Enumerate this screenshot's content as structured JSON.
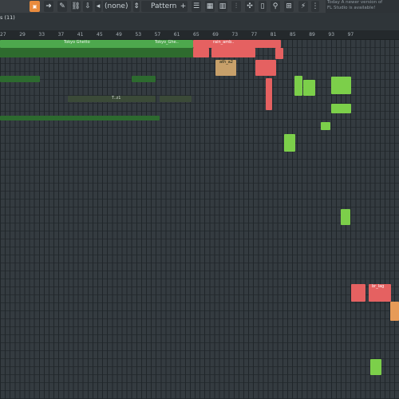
{
  "toolbar": {
    "pattern_label": "Pattern 1",
    "channel_select": "(none)",
    "news_line1": "Today  A newer version of",
    "news_line2": "FL Studio is available!"
  },
  "playlist": {
    "title": "s (11)",
    "ruler_ticks": [
      "27",
      "29",
      "33",
      "37",
      "41",
      "45",
      "49",
      "53",
      "57",
      "61",
      "65",
      "69",
      "73",
      "77",
      "81",
      "85",
      "89",
      "93",
      "97"
    ],
    "clip_labels": {
      "tokyo1": "Tokyo Ghetto",
      "tokyo2": "Tokyo_Ghe..",
      "tokyo3": "Tokyo_Ghe..",
      "rain": "rain_amb..",
      "ath": "ath_a2",
      "tz": "T..z1",
      "br_lag": "br_lag"
    }
  },
  "colors": {
    "green": "#4da84d",
    "dark_green": "#2d6a2f",
    "light_green": "#7ccf4a",
    "red": "#e56161",
    "orange": "#e79b57"
  }
}
